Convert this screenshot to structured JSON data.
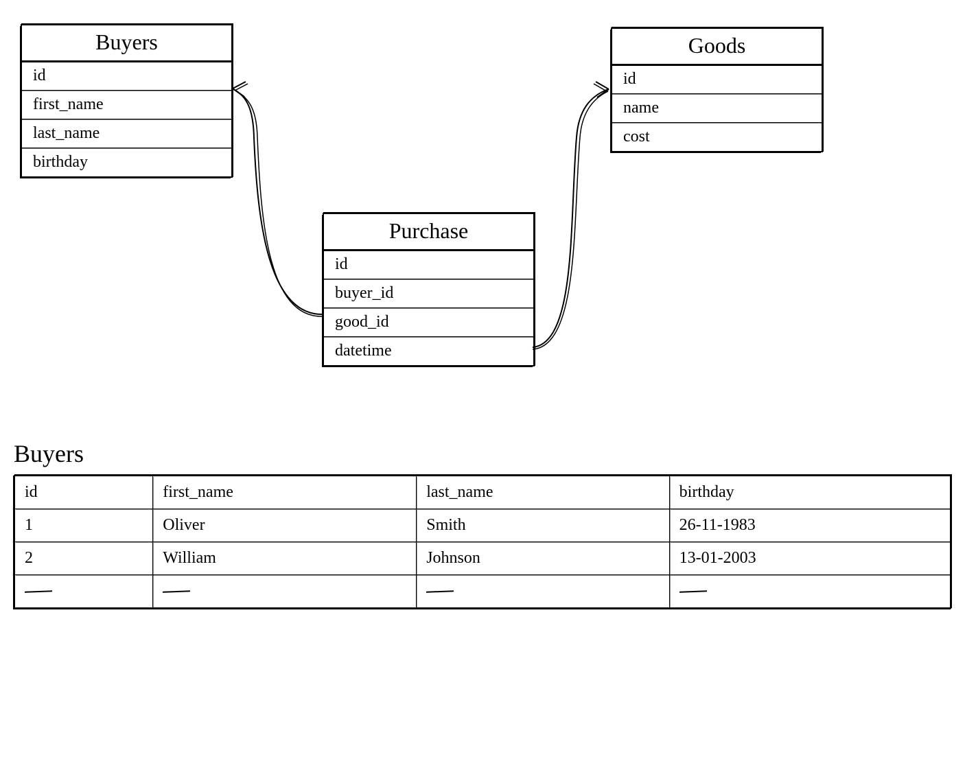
{
  "entities": {
    "buyers": {
      "title": "Buyers",
      "fields": [
        "id",
        "first_name",
        "last_name",
        "birthday"
      ]
    },
    "purchase": {
      "title": "Purchase",
      "fields": [
        "id",
        "buyer_id",
        "good_id",
        "datetime"
      ]
    },
    "goods": {
      "title": "Goods",
      "fields": [
        "id",
        "name",
        "cost"
      ]
    }
  },
  "data_table": {
    "title": "Buyers",
    "headers": [
      "id",
      "first_name",
      "last_name",
      "birthday"
    ],
    "rows": [
      [
        "1",
        "Oliver",
        "Smith",
        "26-11-1983"
      ],
      [
        "2",
        "William",
        "Johnson",
        "13-01-2003"
      ],
      [
        "—",
        "—",
        "—",
        "—"
      ]
    ]
  }
}
